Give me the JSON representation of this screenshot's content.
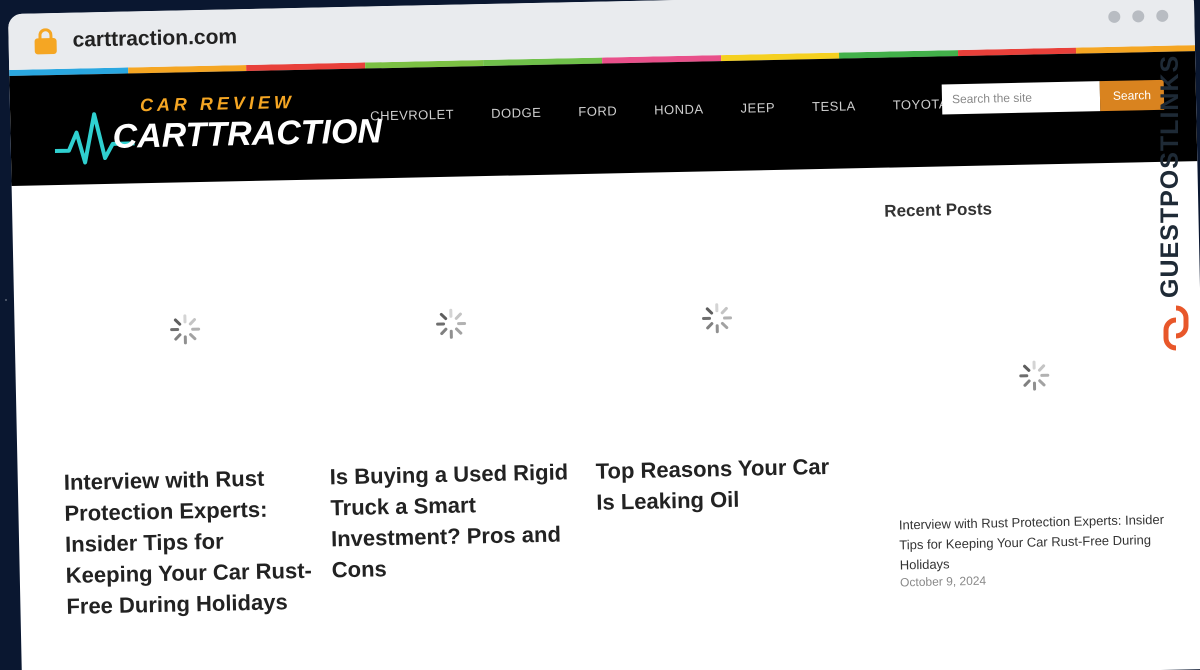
{
  "browser": {
    "url": "carttraction.com"
  },
  "colors": {
    "accent": "#d9831f",
    "rainbow": [
      "#2aa7e0",
      "#f5a623",
      "#e8403a",
      "#7bc043",
      "#6fbf4a",
      "#e8508a",
      "#f5d020",
      "#42b04a",
      "#e8403a",
      "#f5a623"
    ]
  },
  "site": {
    "logo_top": "CAR REVIEW",
    "logo_main": "CARTTRACTION",
    "nav": [
      "CHEVROLET",
      "DODGE",
      "FORD",
      "HONDA",
      "JEEP",
      "TESLA",
      "TOYOTA"
    ],
    "search": {
      "placeholder": "Search the site",
      "button": "Search"
    }
  },
  "posts": [
    {
      "title": "Interview with Rust Protection Experts: Insider Tips for Keeping Your Car Rust-Free During Holidays"
    },
    {
      "title": "Is Buying a Used Rigid Truck a Smart Investment? Pros and Cons"
    },
    {
      "title": "Top Reasons Your Car Is Leaking Oil"
    }
  ],
  "sidebar": {
    "title": "Recent Posts",
    "post": {
      "title": "Interview with Rust Protection Experts: Insider Tips for Keeping Your Car Rust-Free During Holidays",
      "date": "October 9, 2024"
    }
  },
  "watermark": {
    "text": "GUESTPOSTLINKS"
  },
  "icons": [
    "lock-icon",
    "spinner-icon",
    "guestpostlinks-logo-icon"
  ]
}
